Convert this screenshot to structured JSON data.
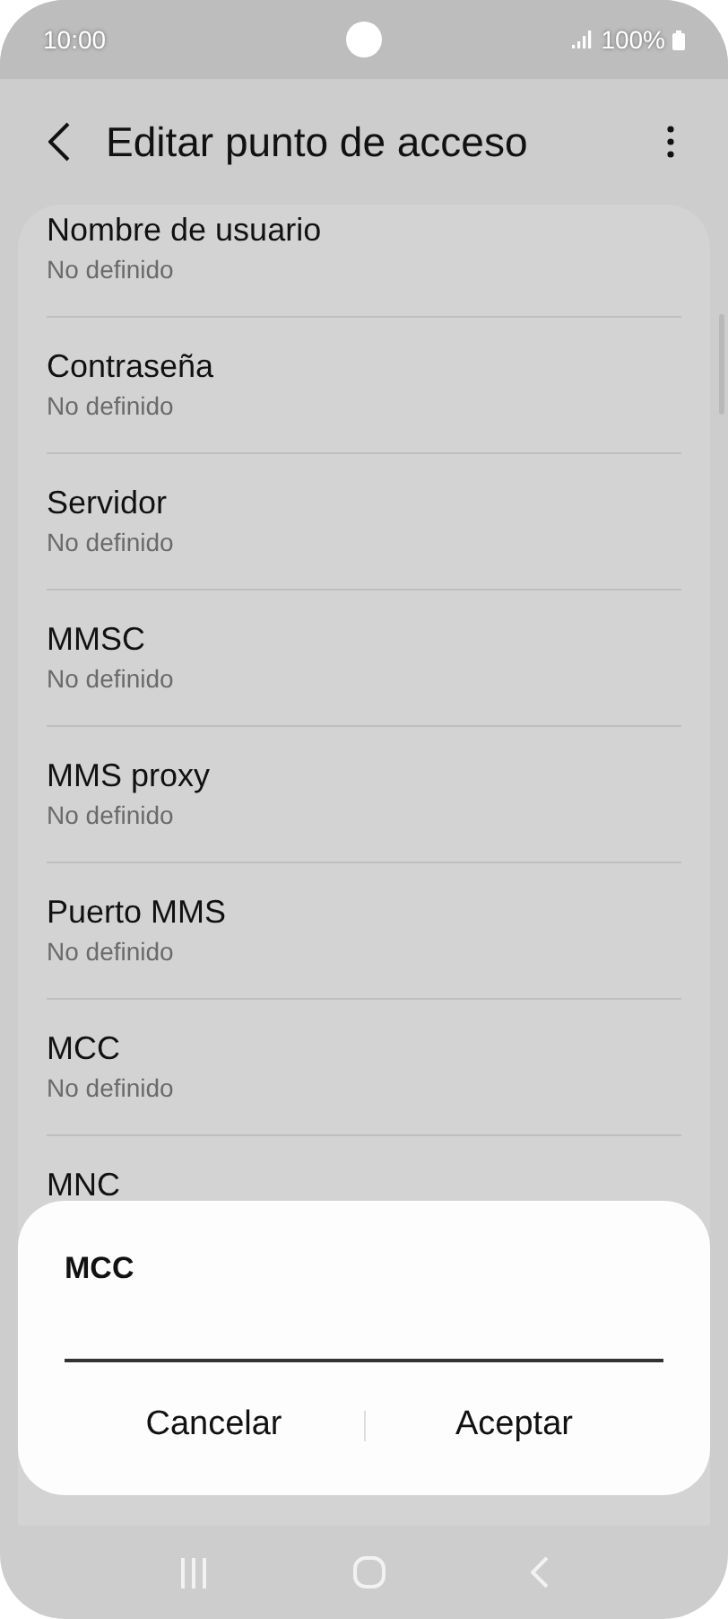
{
  "status_bar": {
    "time": "10:00",
    "battery": "100%"
  },
  "header": {
    "title": "Editar punto de acceso"
  },
  "items": [
    {
      "title": "Nombre de usuario",
      "subtitle": "No definido"
    },
    {
      "title": "Contraseña",
      "subtitle": "No definido"
    },
    {
      "title": "Servidor",
      "subtitle": "No definido"
    },
    {
      "title": "MMSC",
      "subtitle": "No definido"
    },
    {
      "title": "MMS proxy",
      "subtitle": "No definido"
    },
    {
      "title": "Puerto MMS",
      "subtitle": "No definido"
    },
    {
      "title": "MCC",
      "subtitle": "No definido"
    },
    {
      "title": "MNC"
    }
  ],
  "dialog": {
    "title": "MCC",
    "buttons": [
      "Cancelar",
      "Aceptar"
    ]
  }
}
